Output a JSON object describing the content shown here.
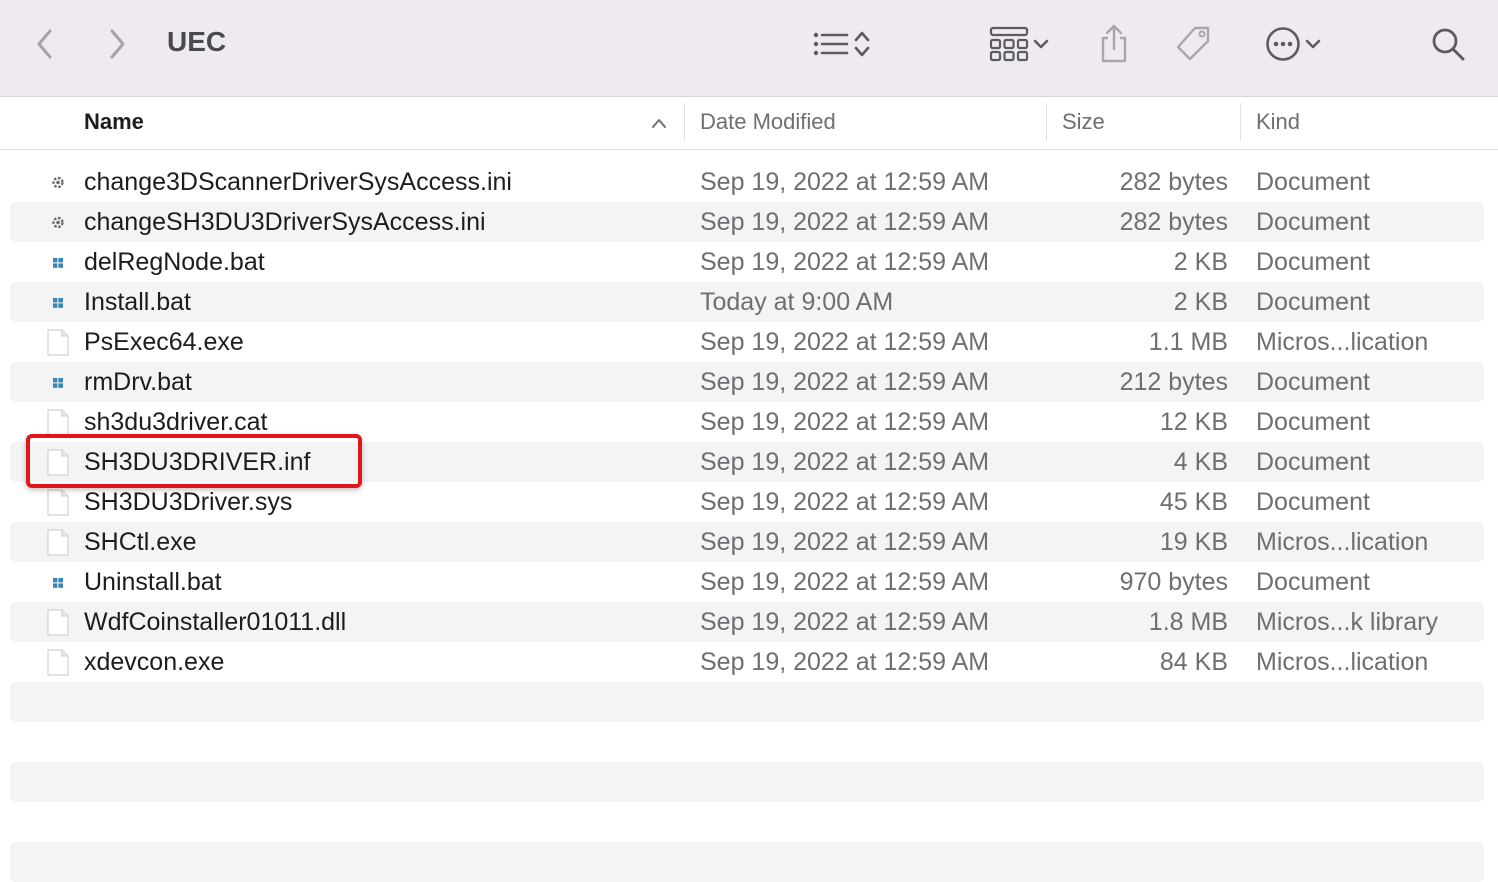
{
  "window": {
    "title": "UEC"
  },
  "toolbar": {
    "icons": [
      "back-icon",
      "forward-icon",
      "list-view-icon",
      "sort-updown-icon",
      "group-grid-icon",
      "chevron-down-icon",
      "share-icon",
      "tag-icon",
      "more-icon",
      "search-icon"
    ]
  },
  "columns": {
    "name": "Name",
    "date": "Date Modified",
    "size": "Size",
    "kind": "Kind"
  },
  "files": [
    {
      "name": "change3DScannerDriverSysAccess.ini",
      "date": "Sep 19, 2022 at 12:59 AM",
      "size": "282 bytes",
      "kind": "Document",
      "icon": "gear-file-icon"
    },
    {
      "name": "changeSH3DU3DriverSysAccess.ini",
      "date": "Sep 19, 2022 at 12:59 AM",
      "size": "282 bytes",
      "kind": "Document",
      "icon": "gear-file-icon"
    },
    {
      "name": "delRegNode.bat",
      "date": "Sep 19, 2022 at 12:59 AM",
      "size": "2 KB",
      "kind": "Document",
      "icon": "windows-file-icon"
    },
    {
      "name": "Install.bat",
      "date": "Today at 9:00 AM",
      "size": "2 KB",
      "kind": "Document",
      "icon": "windows-file-icon"
    },
    {
      "name": "PsExec64.exe",
      "date": "Sep 19, 2022 at 12:59 AM",
      "size": "1.1 MB",
      "kind": "Micros...lication",
      "icon": "blank-file-icon"
    },
    {
      "name": "rmDrv.bat",
      "date": "Sep 19, 2022 at 12:59 AM",
      "size": "212 bytes",
      "kind": "Document",
      "icon": "windows-file-icon"
    },
    {
      "name": "sh3du3driver.cat",
      "date": "Sep 19, 2022 at 12:59 AM",
      "size": "12 KB",
      "kind": "Document",
      "icon": "blank-file-icon"
    },
    {
      "name": "SH3DU3DRIVER.inf",
      "date": "Sep 19, 2022 at 12:59 AM",
      "size": "4 KB",
      "kind": "Document",
      "icon": "blank-file-icon"
    },
    {
      "name": "SH3DU3Driver.sys",
      "date": "Sep 19, 2022 at 12:59 AM",
      "size": "45 KB",
      "kind": "Document",
      "icon": "blank-file-icon"
    },
    {
      "name": "SHCtl.exe",
      "date": "Sep 19, 2022 at 12:59 AM",
      "size": "19 KB",
      "kind": "Micros...lication",
      "icon": "blank-file-icon"
    },
    {
      "name": "Uninstall.bat",
      "date": "Sep 19, 2022 at 12:59 AM",
      "size": "970 bytes",
      "kind": "Document",
      "icon": "windows-file-icon"
    },
    {
      "name": "WdfCoinstaller01011.dll",
      "date": "Sep 19, 2022 at 12:59 AM",
      "size": "1.8 MB",
      "kind": "Micros...k library",
      "icon": "blank-file-icon"
    },
    {
      "name": "xdevcon.exe",
      "date": "Sep 19, 2022 at 12:59 AM",
      "size": "84 KB",
      "kind": "Micros...lication",
      "icon": "blank-file-icon"
    }
  ],
  "highlighted_file": "SH3DU3DRIVER.inf",
  "colors": {
    "highlight": "#e0161b",
    "toolbar_bg": "#efeaf1",
    "stripe": "#f4f4f5"
  }
}
